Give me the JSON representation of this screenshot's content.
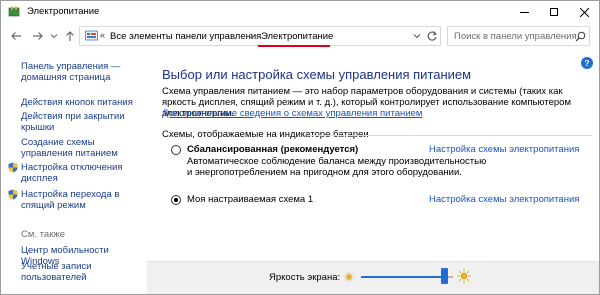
{
  "window": {
    "title": "Электропитание",
    "minimize_icon": "minimize-icon",
    "maximize_icon": "maximize-icon",
    "close_icon": "close-icon"
  },
  "address_bar": {
    "overflow": "«",
    "crumbs": [
      "Все элементы панели управления",
      "Электропитание"
    ],
    "separator": "›",
    "active_crumb_highlight": "#e0001b"
  },
  "search": {
    "placeholder": "Поиск в панели управления"
  },
  "sidebar": {
    "home_link": "Панель управления — домашняя страница",
    "links": [
      "Действия кнопок питания",
      "Действия при закрытии крышки",
      "Создание схемы управления питанием",
      "Настройка отключения дисплея",
      "Настройка перехода в спящий режим"
    ],
    "see_also_label": "См. также",
    "see_also_links": [
      "Центр мобильности Windows",
      "Учетные записи пользователей"
    ]
  },
  "main": {
    "help_label": "?",
    "title": "Выбор или настройка схемы управления питанием",
    "description": "Схема управления питанием — это набор параметров оборудования и системы (таких как яркость дисплея, спящий режим и т. д.), который контролирует использование компьютером электроэнергии.",
    "description_link": "Дополнительные сведения о схемах управления питанием",
    "group_label": "Схемы, отображаемые на индикаторе батареи",
    "plans": [
      {
        "name": "Сбалансированная (рекомендуется)",
        "selected": false,
        "description": "Автоматическое соблюдение баланса между производительностью и энергопотреблением на пригодном для этого оборудовании.",
        "settings_link": "Настройка схемы электропитания"
      },
      {
        "name": "Моя настраиваемая схема 1",
        "selected": true,
        "description": "",
        "settings_link": "Настройка схемы электропитания"
      }
    ]
  },
  "footer": {
    "brightness_label": "Яркость экрана:",
    "brightness_fraction": 0.9,
    "accent_color": "#1e6fd1"
  }
}
